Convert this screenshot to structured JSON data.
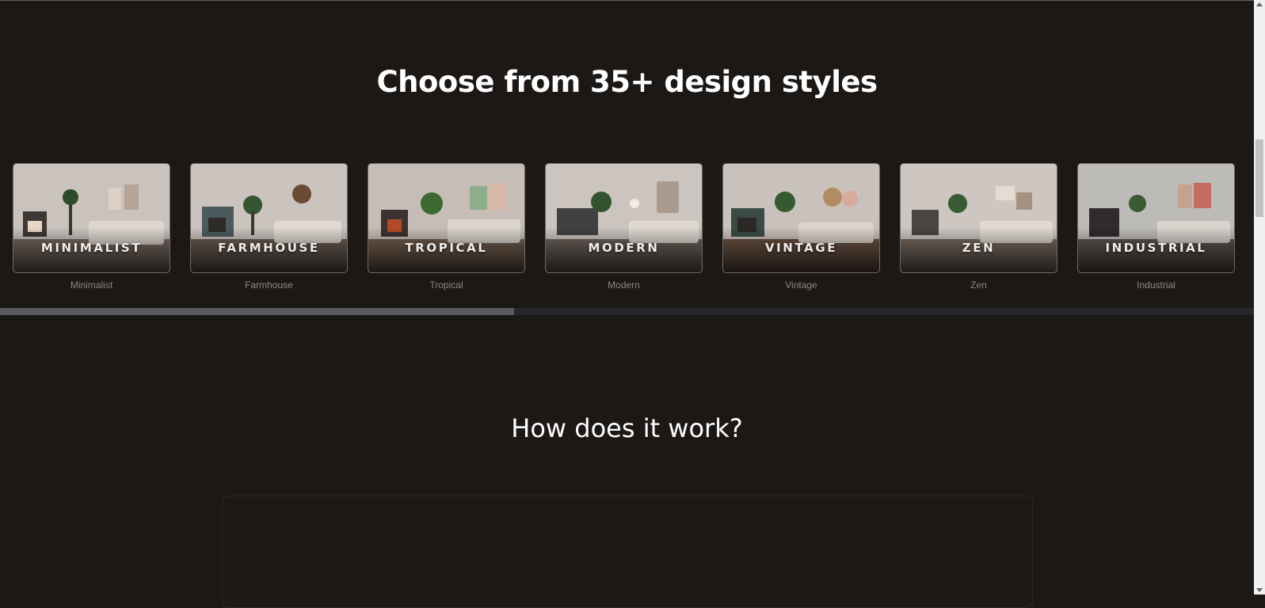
{
  "section_styles": {
    "title": "Choose from 35+ design styles",
    "cards": [
      {
        "overlay": "MINIMALIST",
        "caption": "Minimalist"
      },
      {
        "overlay": "FARMHOUSE",
        "caption": "Farmhouse"
      },
      {
        "overlay": "TROPICAL",
        "caption": "Tropical"
      },
      {
        "overlay": "MODERN",
        "caption": "Modern"
      },
      {
        "overlay": "VINTAGE",
        "caption": "Vintage"
      },
      {
        "overlay": "ZEN",
        "caption": "Zen"
      },
      {
        "overlay": "INDUSTRIAL",
        "caption": "Industrial"
      }
    ],
    "scroll_progress": 0.41
  },
  "section_how": {
    "title": "How does it work?"
  },
  "colors": {
    "background": "#1c1816",
    "card_border": "#6f6a66",
    "caption": "#8f8883",
    "scroll_track": "#27262a",
    "scroll_thumb": "#595a60"
  }
}
